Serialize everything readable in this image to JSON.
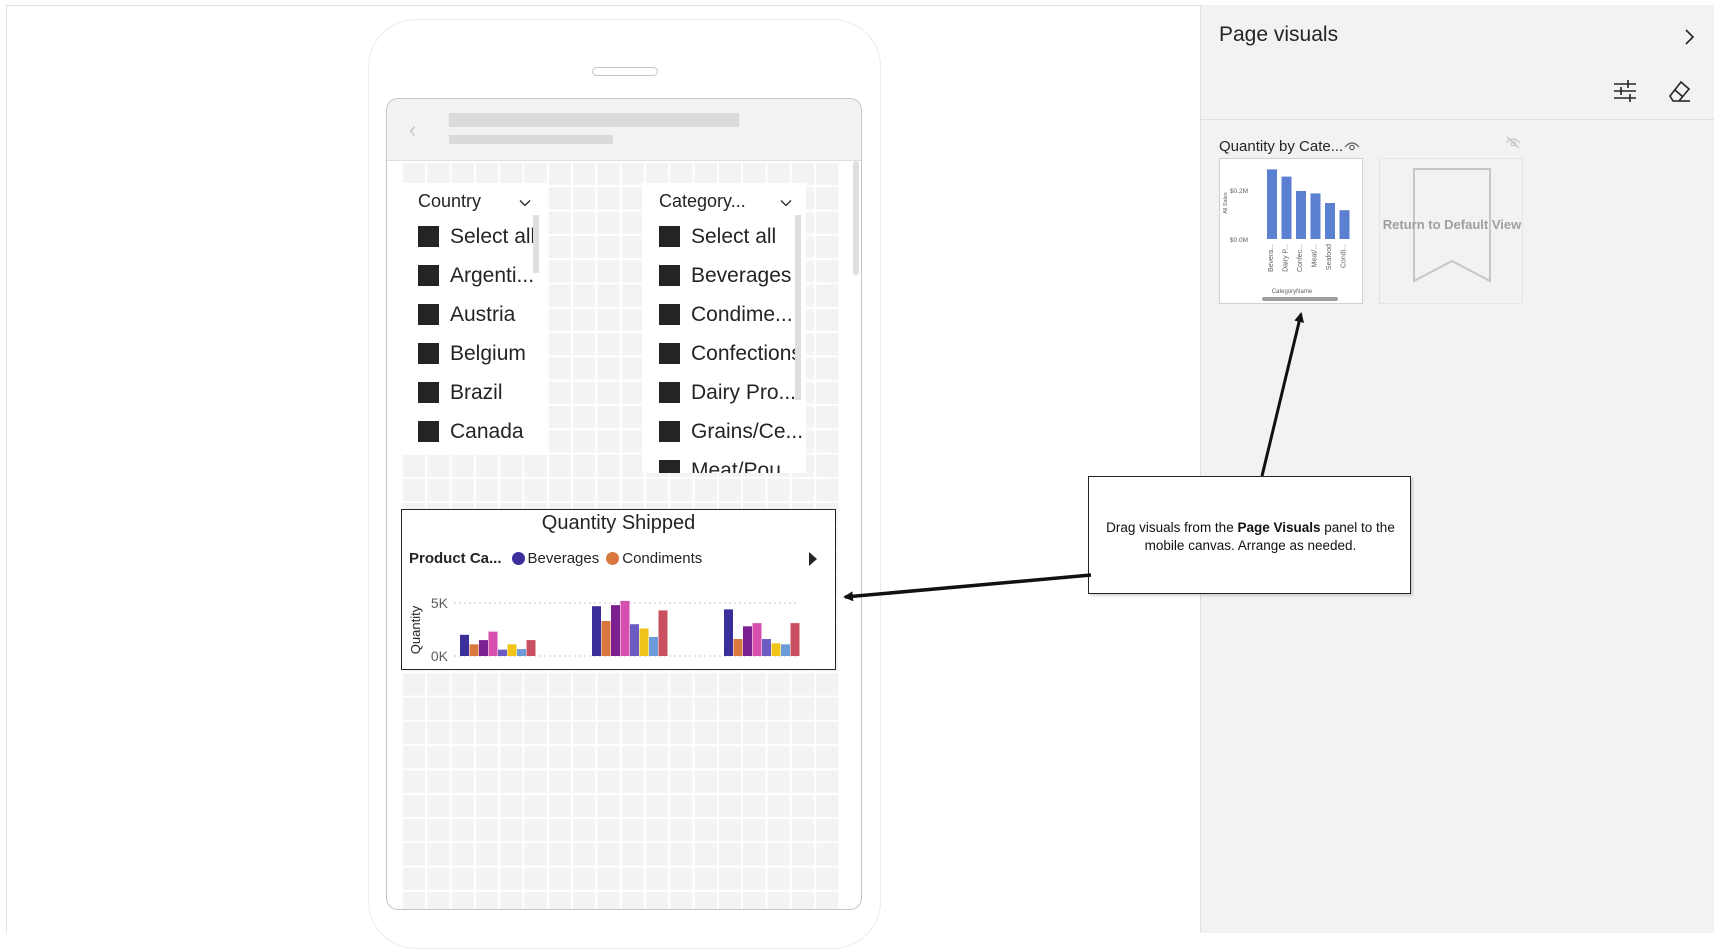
{
  "phone": {
    "slicers": [
      {
        "header": "Country",
        "items": [
          "Select all",
          "Argenti...",
          "Austria",
          "Belgium",
          "Brazil",
          "Canada"
        ]
      },
      {
        "header": "Category...",
        "items": [
          "Select all",
          "Beverages",
          "Condime...",
          "Confections",
          "Dairy Pro...",
          "Grains/Ce...",
          "Meat/Pou..."
        ]
      }
    ],
    "visual": {
      "title": "Quantity Shipped",
      "legend_title": "Product Ca...",
      "legend_items": [
        {
          "label": "Beverages",
          "color": "#3b2f9c"
        },
        {
          "label": "Condiments",
          "color": "#d8783f"
        }
      ]
    }
  },
  "panel": {
    "title": "Page visuals",
    "visual_name": "Quantity by Cate...",
    "bookmark_label": "Return to Default View"
  },
  "callout": {
    "text_before": "Drag visuals from the ",
    "text_bold": "Page Visuals",
    "text_after": " panel to the mobile canvas. Arrange as needed."
  },
  "chart_data": [
    {
      "type": "bar",
      "title": "Quantity Shipped",
      "ylabel": "Quantity",
      "yticks": [
        "5K",
        "0K"
      ],
      "ylim": [
        0,
        5500
      ],
      "grid": true,
      "legend_position": "top-left",
      "colors": [
        "#3b2f9c",
        "#d8783f",
        "#7c1f8f",
        "#d44fae",
        "#6a5cc2",
        "#f0c419",
        "#6b9bd8",
        "#c9505f"
      ],
      "groups": [
        {
          "values": [
            2000,
            1100,
            1500,
            2300,
            600,
            1100,
            650,
            1500
          ]
        },
        {
          "values": [
            4700,
            3300,
            4800,
            5200,
            3000,
            2600,
            1800,
            4300
          ]
        },
        {
          "values": [
            4400,
            1600,
            2800,
            3100,
            1600,
            1200,
            1100,
            3100
          ]
        }
      ]
    },
    {
      "type": "bar",
      "ylabel": "All Sales",
      "xlabel": "CategoryName",
      "yticks": [
        "$0.2M",
        "$0.0M"
      ],
      "ylim": [
        0,
        0.3
      ],
      "categories": [
        "Bevera...",
        "Dairy P...",
        "Confec...",
        "Meat/...",
        "Seafood",
        "Condi..."
      ],
      "values": [
        0.29,
        0.26,
        0.2,
        0.19,
        0.15,
        0.12
      ],
      "color": "#5b7fd1"
    }
  ]
}
